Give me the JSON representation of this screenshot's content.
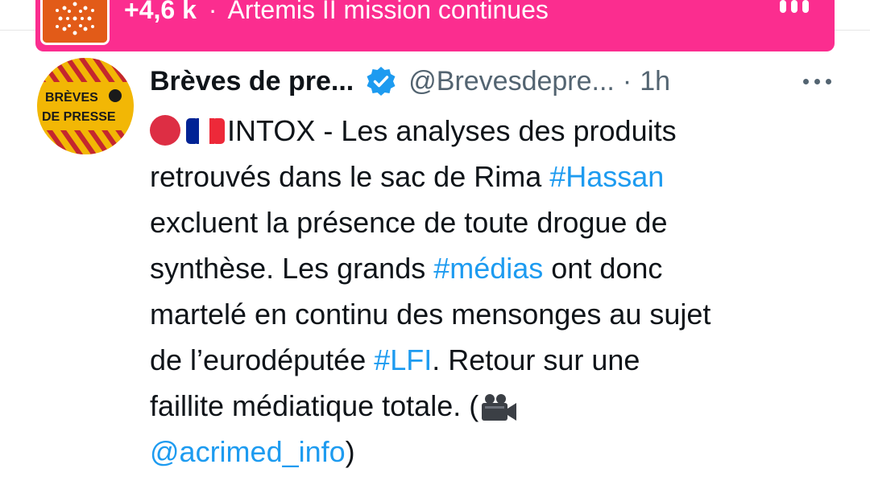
{
  "banner": {
    "count": "+4,6 k",
    "separator": "·",
    "title": "Artemis II mission continues",
    "thumb_icon": "sun-pattern-thumbnail",
    "more_icon": "more-dots-icon",
    "background_color": "#fb2d8f"
  },
  "tweet": {
    "avatar_text_line1": "BRÈVES",
    "avatar_text_line2": "DE PRESSE",
    "author_name": "Brèves de pre...",
    "verified_icon": "verified-badge-icon",
    "handle": "@Brevesdepre...",
    "separator": "·",
    "time": "1h",
    "menu_icon": "more-horizontal-icon",
    "body": {
      "line1_text": "INTOX - Les analyses des produits",
      "line2_text": "retrouvés dans le sac de Rima ",
      "line2_hashtag": "#Hassan",
      "line3_text": "excluent la présence de toute drogue de",
      "line4_text_a": "synthèse. Les grands ",
      "line4_hashtag": "#médias",
      "line4_text_b": " ont donc",
      "line5_text": "martelé en continu des mensonges au sujet",
      "line6_text_a": "de l’eurodéputée ",
      "line6_hashtag": "#LFI",
      "line6_text_b": ". Retour sur une",
      "line7_text": "faillite médiatique totale. (",
      "line8_mention": "@acrimed_info",
      "line8_text": ")"
    },
    "emoji_icons": [
      "red-circle-icon",
      "france-flag-icon",
      "video-camera-icon"
    ],
    "link_color": "#1d9bf0",
    "text_color": "#0f1419",
    "muted_color": "#536471"
  }
}
